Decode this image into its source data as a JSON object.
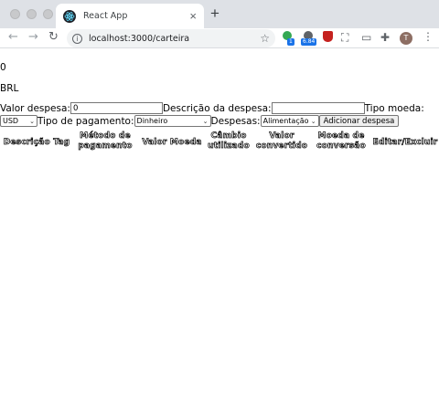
{
  "browser": {
    "tab_title": "React App",
    "tab_close_glyph": "×",
    "new_tab_glyph": "+",
    "url": "localhost:3000/carteira",
    "nav_back": "←",
    "nav_forward": "→",
    "nav_reload": "↻",
    "star_glyph": "☆",
    "extensions": {
      "ext1_badge": "1",
      "ext2_badge": "6.84"
    },
    "avatar_initial": "T",
    "menu_glyph": "⋮"
  },
  "wallet": {
    "total": "0",
    "currency": "BRL"
  },
  "form": {
    "value_label": "Valor despesa:",
    "value_input": "0",
    "description_label": "Descrição da despesa:",
    "description_input": "",
    "currency_label": "Tipo moeda:",
    "currency_selected": "USD",
    "payment_label": "Tipo de pagamento:",
    "payment_selected": "Dinheiro",
    "tag_label": "Despesas:",
    "tag_selected": "Alimentação",
    "submit_label": "Adicionar despesa"
  },
  "table": {
    "headers": [
      "Descrição Tag",
      "Método de pagamento",
      "Valor Moeda",
      "Câmbio utilizado",
      "Valor convertido",
      "Moeda de conversão",
      "Editar/Excluir"
    ]
  },
  "colors": {
    "tabstrip": "#dee1e6",
    "omnibox": "#f1f3f4",
    "accent_badge": "#1a73e8"
  }
}
